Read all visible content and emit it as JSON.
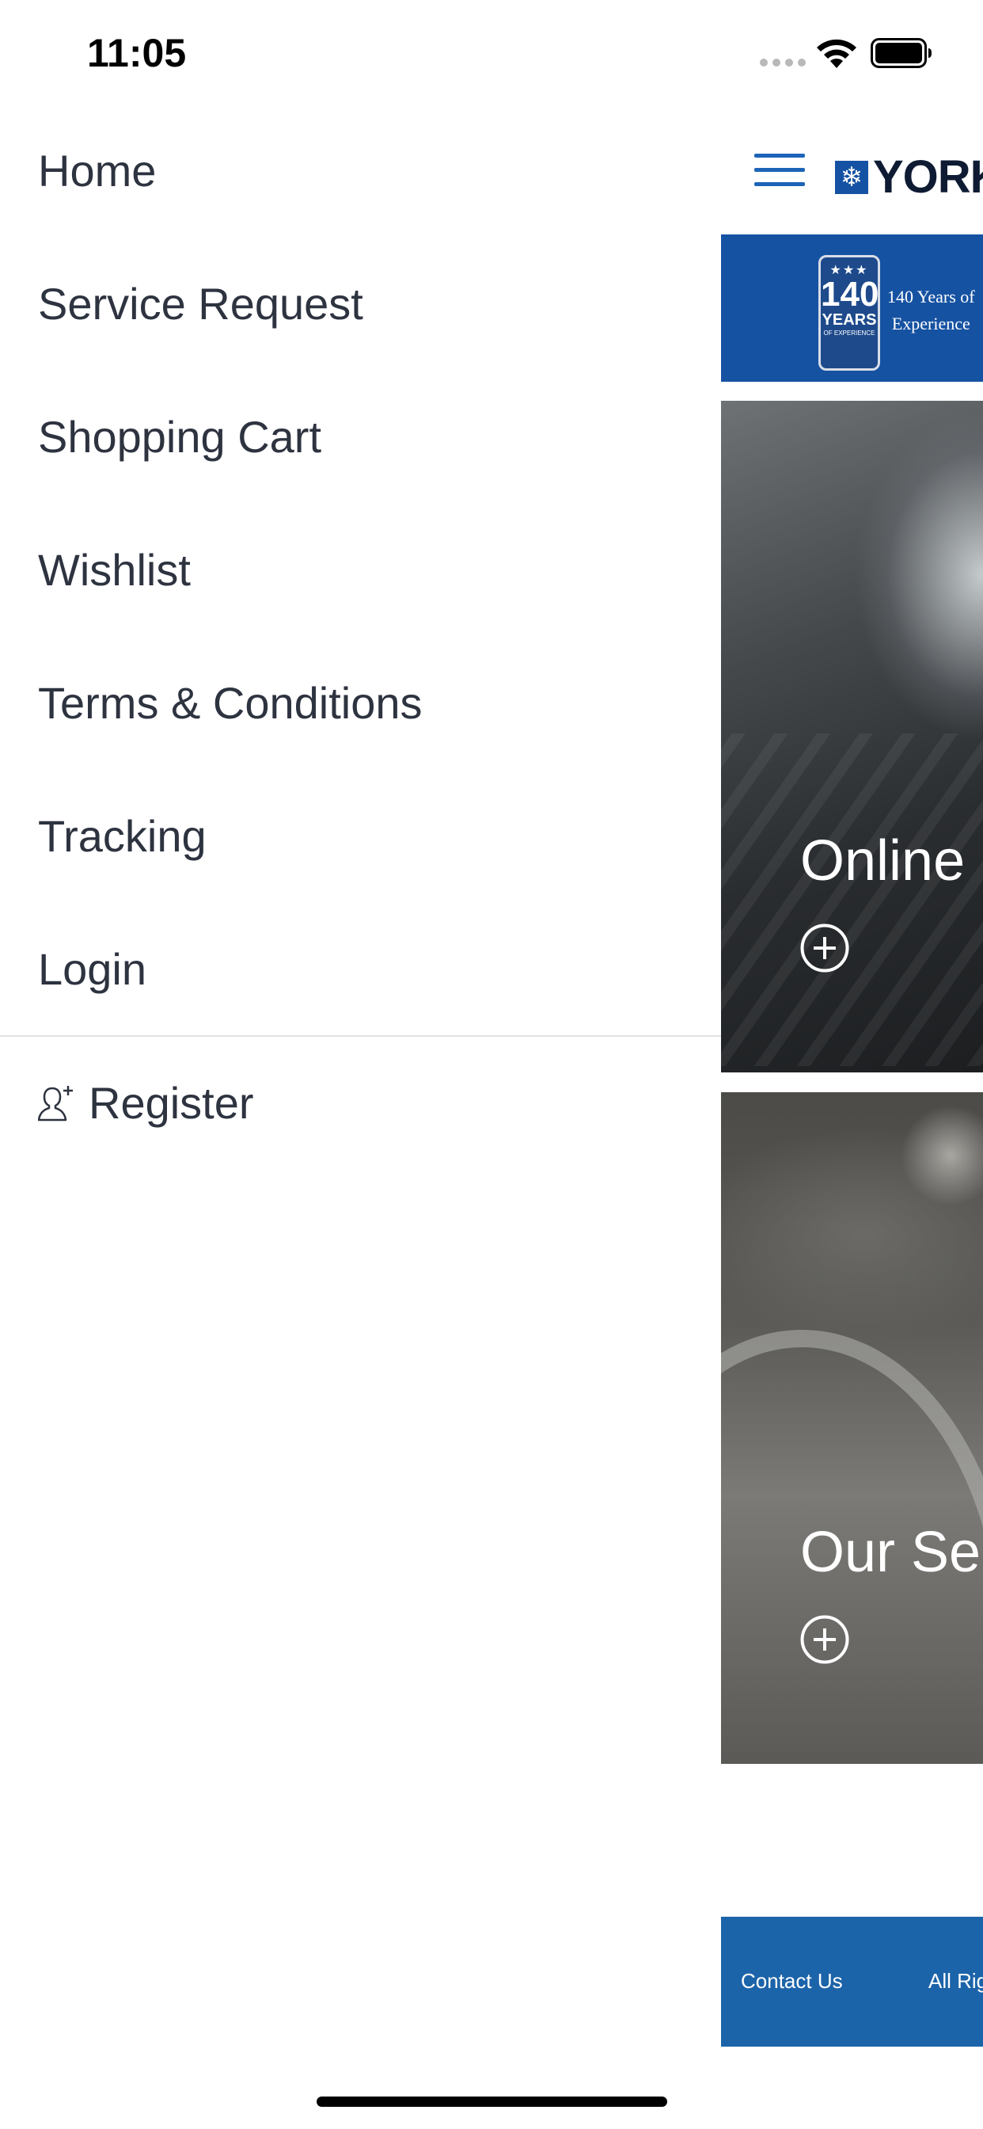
{
  "status_bar": {
    "time": "11:05",
    "icons": [
      "signal-dots-icon",
      "wifi-icon",
      "battery-icon"
    ]
  },
  "drawer": {
    "items": [
      {
        "label": "Home"
      },
      {
        "label": "Service Request"
      },
      {
        "label": "Shopping Cart"
      },
      {
        "label": "Wishlist"
      },
      {
        "label": "Terms & Conditions"
      },
      {
        "label": "Tracking"
      },
      {
        "label": "Login"
      }
    ],
    "register": {
      "label": "Register",
      "icon": "add-user-icon"
    }
  },
  "app": {
    "header": {
      "logo_text": "YORK",
      "menu_icon": "hamburger-icon"
    },
    "banner": {
      "badge_num": "140",
      "badge_years": "YEARS",
      "badge_sub": "OF EXPERIENCE",
      "caption_line1": "140 Years of",
      "caption_line2": "Experience"
    },
    "cards": [
      {
        "title": "Online",
        "icon": "plus-circle-icon"
      },
      {
        "title": "Our Se",
        "icon": "plus-circle-icon"
      }
    ],
    "footer": {
      "contact": "Contact Us",
      "rights": "All Rig"
    }
  },
  "colors": {
    "brand_blue": "#1652a2",
    "footer_blue": "#1c64a9",
    "menu_text": "#2e3340",
    "hamburger_blue": "#1d64b8"
  }
}
